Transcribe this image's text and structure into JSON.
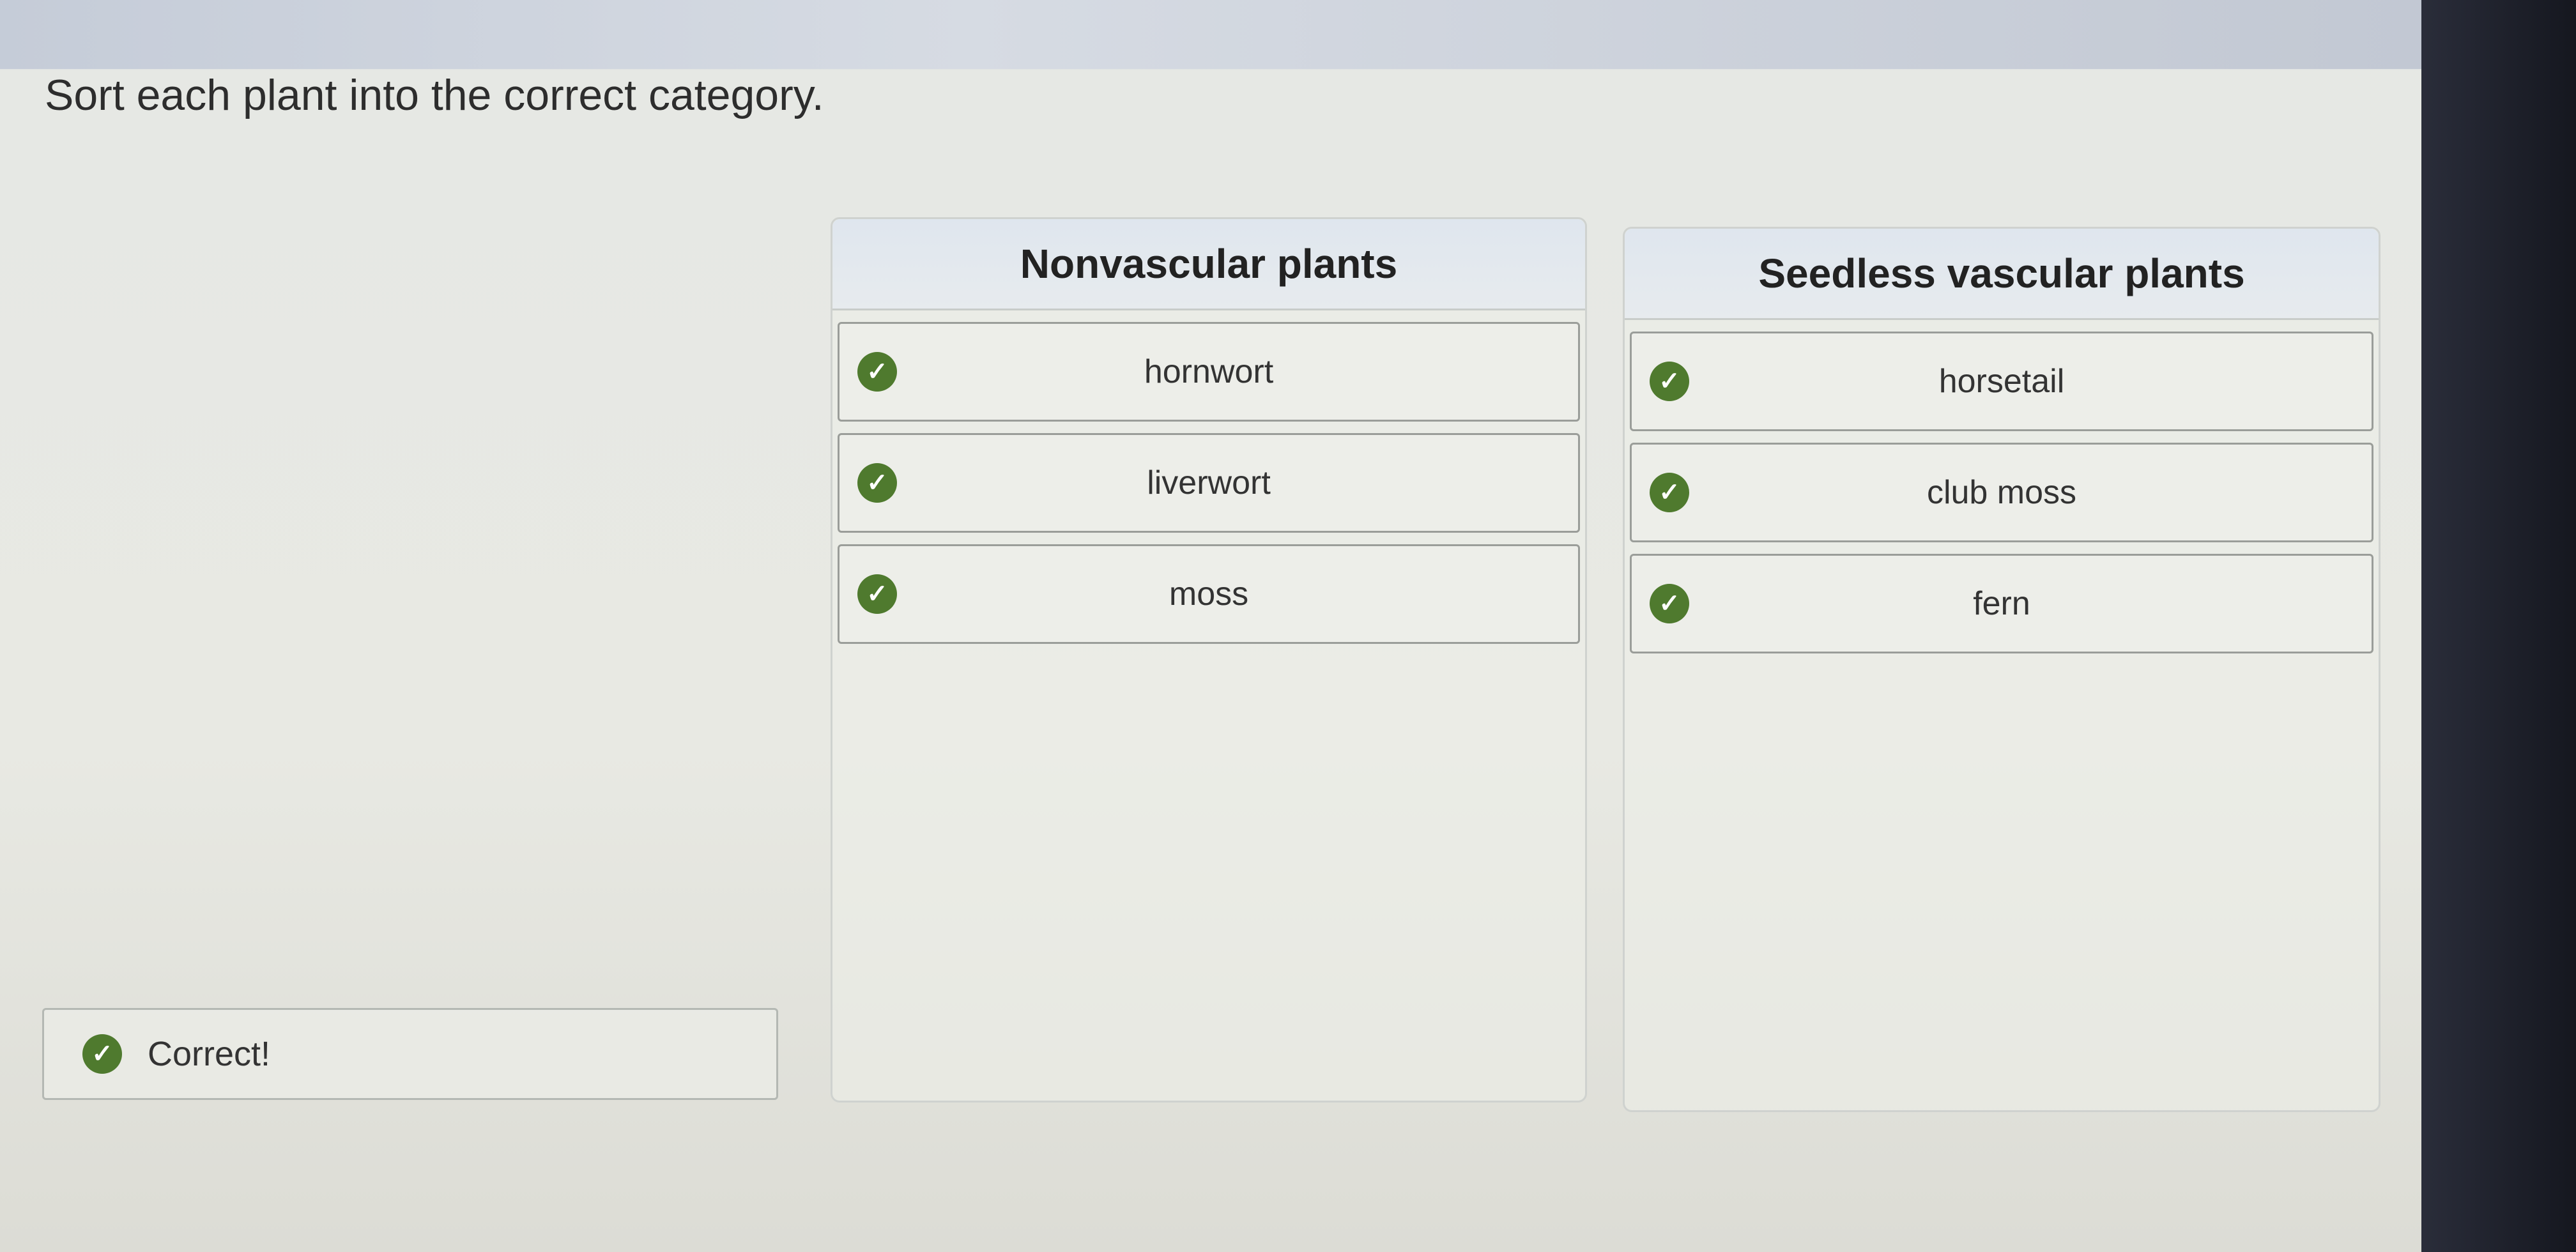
{
  "prompt": "Sort each plant into the correct category.",
  "categories": [
    {
      "title": "Nonvascular plants",
      "items": [
        "hornwort",
        "liverwort",
        "moss"
      ]
    },
    {
      "title": "Seedless vascular plants",
      "items": [
        "horsetail",
        "club moss",
        "fern"
      ]
    }
  ],
  "feedback": {
    "text": "Correct!",
    "icon": "check-circle-icon",
    "status_color": "#4f7a2e"
  }
}
